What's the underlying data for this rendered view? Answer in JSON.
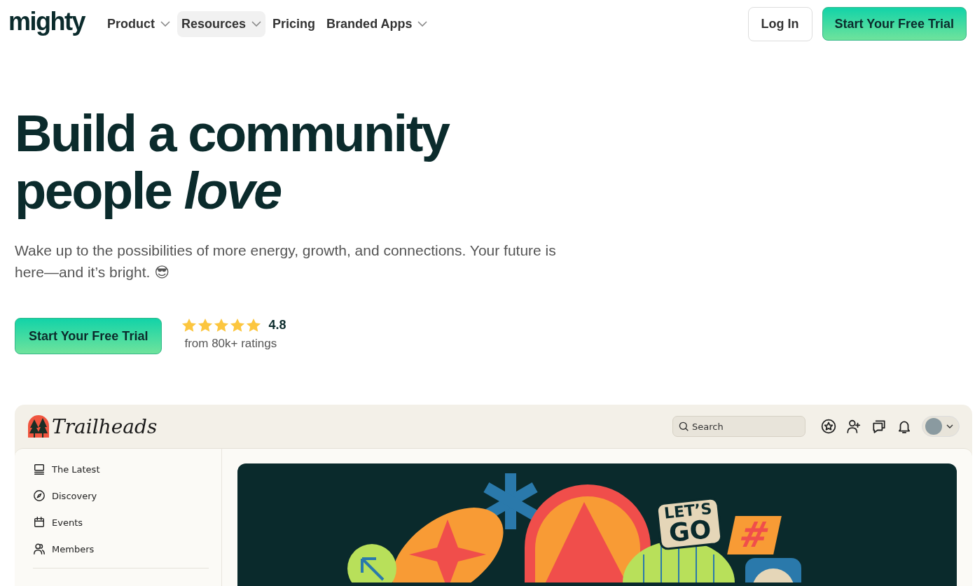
{
  "header": {
    "logo": "mighty",
    "nav": [
      {
        "label": "Product",
        "dropdown": true,
        "highlighted": false
      },
      {
        "label": "Resources",
        "dropdown": true,
        "highlighted": true
      },
      {
        "label": "Pricing",
        "dropdown": false,
        "highlighted": false
      },
      {
        "label": "Branded Apps",
        "dropdown": true,
        "highlighted": false
      }
    ],
    "login": "Log In",
    "cta": "Start Your Free Trial"
  },
  "hero": {
    "title": "Build a community people *love*",
    "subtitle": "Wake up to the possibilities of more energy, growth, and connections. Your future is here—and it’s bright. 😎",
    "cta": "Start Your Free Trial",
    "rating": {
      "stars": 5,
      "score": "4.8",
      "caption": "from 80k+ ratings"
    }
  },
  "preview": {
    "brand": "Trailheads",
    "search": {
      "placeholder": "Search"
    },
    "toolbar": [
      {
        "kind": "star"
      },
      {
        "kind": "add-user"
      },
      {
        "kind": "chat"
      },
      {
        "kind": "bell"
      }
    ],
    "sidebar": [
      {
        "kind": "monitor",
        "label": "The Latest"
      },
      {
        "kind": "compass",
        "label": "Discovery"
      },
      {
        "kind": "calendar",
        "label": "Events"
      },
      {
        "kind": "members",
        "label": "Members"
      }
    ],
    "banner": {
      "sticker_top": "LET’S",
      "sticker_bottom": "GO",
      "badge": "#"
    }
  }
}
